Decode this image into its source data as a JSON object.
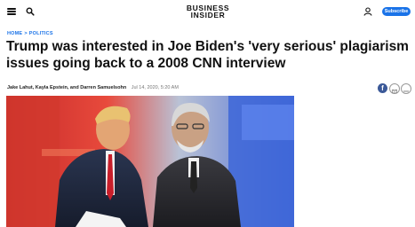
{
  "header": {
    "logo_line1": "BUSINESS",
    "logo_line2": "INSIDER",
    "subscribe_label": "Subscribe",
    "menu_icon": "hamburger-menu-icon",
    "search_icon": "search-icon",
    "user_icon": "user-icon"
  },
  "breadcrumb": {
    "home": "HOME",
    "separator": ">",
    "section": "POLITICS"
  },
  "article": {
    "headline": "Trump was interested in Joe Biden's 'very serious' plagiarism issues going back to a 2008 CNN interview",
    "authors": "Jake Lahut, Kayla Epstein, and Darren Samuelsohn",
    "date": "Jul 14, 2020, 5:20 AM"
  },
  "share": {
    "facebook_icon": "facebook-icon",
    "email_icon": "email-icon",
    "more_icon": "more-icon"
  },
  "colors": {
    "accent": "#1a73e8",
    "facebook": "#3b5998"
  }
}
